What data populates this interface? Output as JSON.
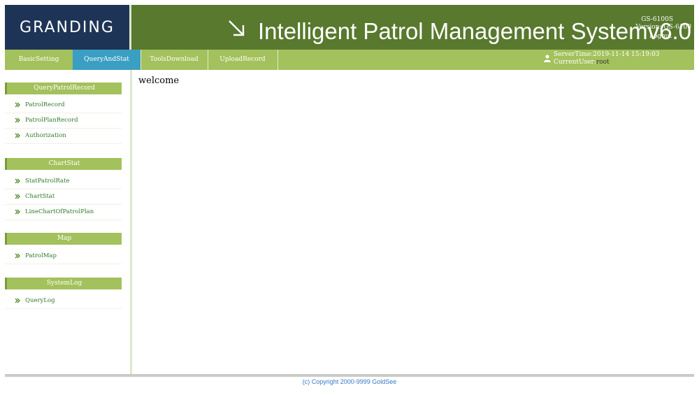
{
  "header": {
    "logo": "GRANDING",
    "system_title": "Intelligent Patrol Management Systemv6.0",
    "model": "GS-6100S",
    "version": "Version: GS-6100",
    "logout": "Logout"
  },
  "nav": {
    "tabs": [
      {
        "label": "BasicSetting",
        "active": false
      },
      {
        "label": "QueryAndStat",
        "active": true
      },
      {
        "label": "ToolsDownload",
        "active": false
      },
      {
        "label": "UploadRecord",
        "active": false
      }
    ],
    "server_time": "ServerTime:2019-11-14 15:19:03",
    "current_user_label": "CurrentUser:",
    "current_user": "root"
  },
  "sidebar": {
    "sections": [
      {
        "title": "QueryPatrolRecord",
        "items": [
          "PatrolRecord",
          "PatrolPlanRecord",
          "Authorization"
        ]
      },
      {
        "title": "ChartStat",
        "items": [
          "StatPatrolRate",
          "ChartStat",
          "LineChartOfPatrolPlan"
        ]
      },
      {
        "title": "Map",
        "items": [
          "PatrolMap"
        ]
      },
      {
        "title": "SystemLog",
        "items": [
          "QueryLog"
        ]
      }
    ]
  },
  "main": {
    "welcome": "welcome"
  },
  "footer": {
    "copyright": "(c) Copyright 2000-9999 GoldSee"
  },
  "colors": {
    "banner": "#58792e",
    "logo_bg": "#1d3456",
    "nav": "#a3c15c",
    "active_tab": "#3a9fc2",
    "link": "#2f7a2a"
  }
}
